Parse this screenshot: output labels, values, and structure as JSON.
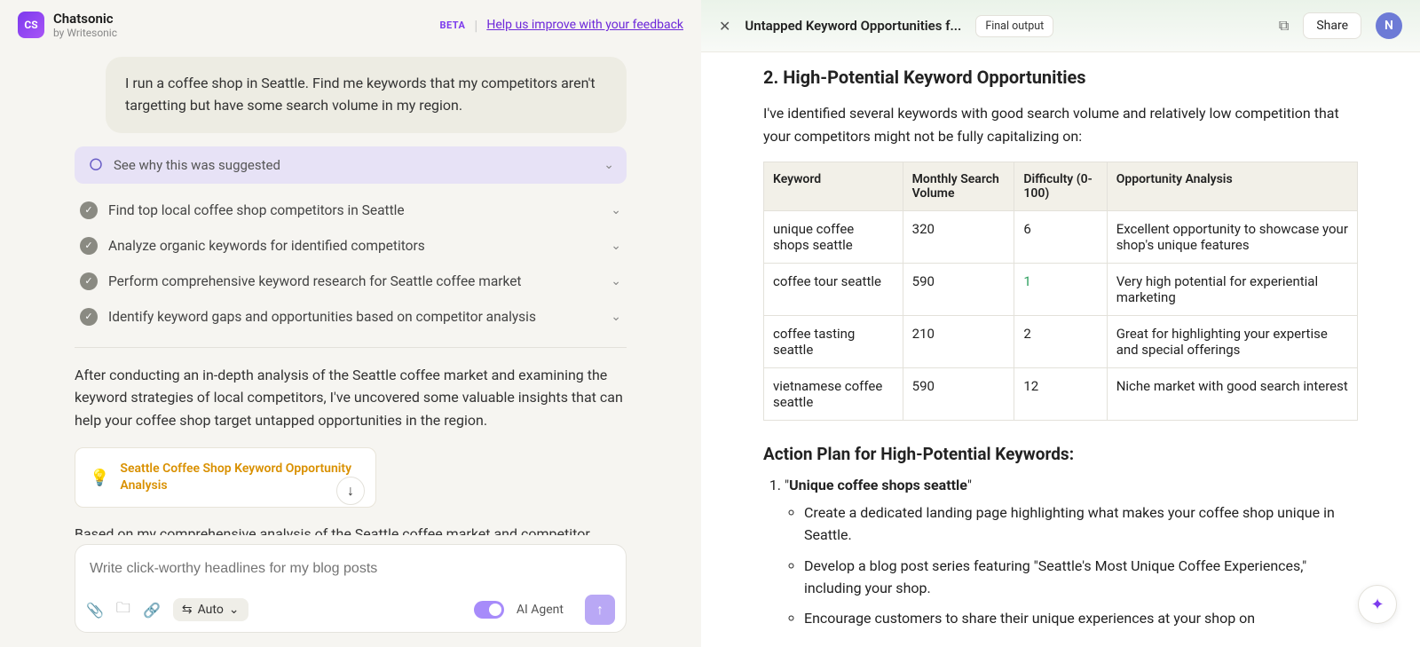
{
  "header": {
    "logo_text": "CS",
    "title": "Chatsonic",
    "subtitle": "by Writesonic",
    "beta": "BETA",
    "feedback": "Help us improve with your feedback"
  },
  "user_message": "I run a coffee shop in Seattle. Find me keywords that my competitors aren't targetting but have some search volume in my region.",
  "suggestion_bar": "See why this was suggested",
  "steps": [
    "Find top local coffee shop competitors in Seattle",
    "Analyze organic keywords for identified competitors",
    "Perform comprehensive keyword research for Seattle coffee market",
    "Identify keyword gaps and opportunities based on competitor analysis"
  ],
  "summary": "After conducting an in-depth analysis of the Seattle coffee market and examining the keyword strategies of local competitors, I've uncovered some valuable insights that can help your coffee shop target untapped opportunities in the region.",
  "result_card": "Seattle Coffee Shop Keyword Opportunity Analysis",
  "followup": "Based on my comprehensive analysis of the Seattle coffee market and competitor",
  "composer": {
    "placeholder": "Write click-worthy headlines for my blog posts",
    "auto": "Auto",
    "agent_label": "AI Agent"
  },
  "right": {
    "doc_title": "Untapped Keyword Opportunities f...",
    "final_label": "Final output",
    "share": "Share",
    "avatar": "N",
    "section_title": "2. High-Potential Keyword Opportunities",
    "intro": "I've identified several keywords with good search volume and relatively low competition that your competitors might not be fully capitalizing on:",
    "table_headers": [
      "Keyword",
      "Monthly Search Volume",
      "Difficulty (0-100)",
      "Opportunity Analysis"
    ],
    "rows": [
      {
        "kw": "unique coffee shops seattle",
        "vol": "320",
        "diff": "6",
        "diff_green": false,
        "opp": "Excellent opportunity to showcase your shop's unique features"
      },
      {
        "kw": "coffee tour seattle",
        "vol": "590",
        "diff": "1",
        "diff_green": true,
        "opp": "Very high potential for experiential marketing"
      },
      {
        "kw": "coffee tasting seattle",
        "vol": "210",
        "diff": "2",
        "diff_green": false,
        "opp": "Great for highlighting your expertise and special offerings"
      },
      {
        "kw": "vietnamese coffee seattle",
        "vol": "590",
        "diff": "12",
        "diff_green": false,
        "opp": "Niche market with good search interest"
      }
    ],
    "action_title": "Action Plan for High-Potential Keywords:",
    "action_item_label_pre": "\"",
    "action_item_label": "Unique coffee shops seattle",
    "action_item_label_post": "\"",
    "bullets": [
      "Create a dedicated landing page highlighting what makes your coffee shop unique in Seattle.",
      "Develop a blog post series featuring \"Seattle's Most Unique Coffee Experiences,\" including your shop.",
      "Encourage customers to share their unique experiences at your shop on"
    ]
  }
}
